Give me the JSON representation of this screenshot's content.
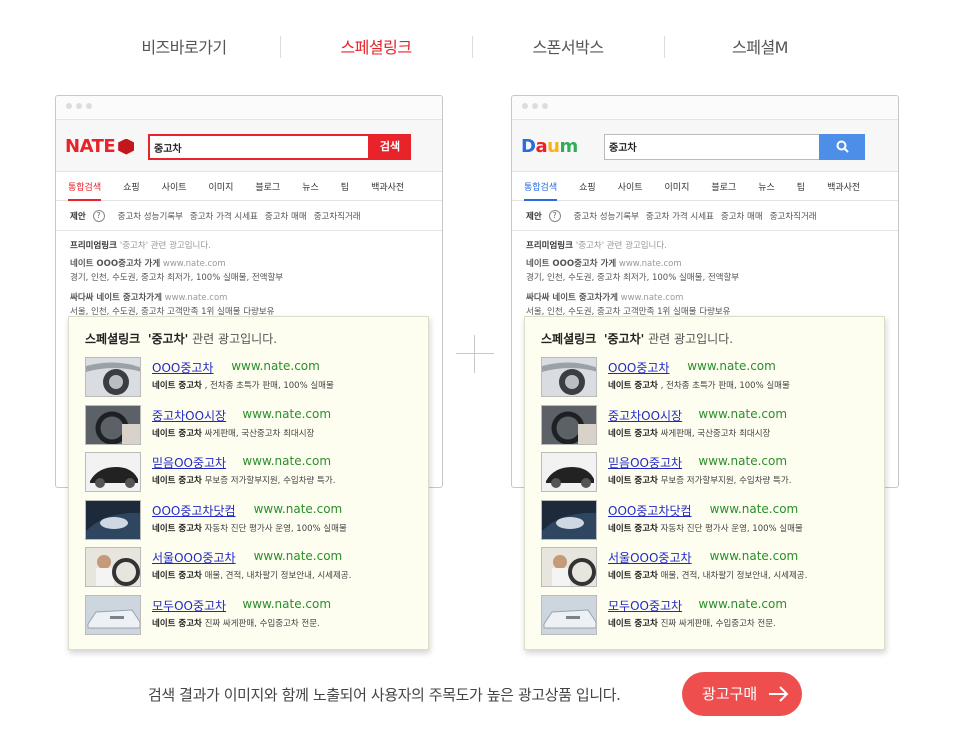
{
  "tabs": [
    "비즈바로가기",
    "스페셜링크",
    "스폰서박스",
    "스페셜M"
  ],
  "active_tab": 1,
  "nate": {
    "logo": "NATE",
    "query": "중고차",
    "search_label": "검색"
  },
  "daum": {
    "logo": [
      "D",
      "a",
      "u",
      "m"
    ],
    "logo_colors": [
      "#2a6be0",
      "#e8232a",
      "#fbb117",
      "#2fae55"
    ],
    "query": "중고차"
  },
  "nav": [
    "통합검색",
    "쇼핑",
    "사이트",
    "이미지",
    "블로그",
    "뉴스",
    "팁",
    "백과사전"
  ],
  "suggest_label": "제안",
  "suggest_help": "?",
  "suggestions": [
    "중고차 성능기록부",
    "중고차 가격 시세표",
    "중고차 매매",
    "중고차직거래"
  ],
  "premium": {
    "title": "프리미엄링크",
    "subtitle": "'중고차' 관련 광고입니다.",
    "r1_title": "네이트 OOO중고차 가게",
    "r1_url": "www.nate.com",
    "r1_desc": "경기, 인천, 수도권, 중고차 최저가, 100% 실매물, 전액할부",
    "r2_title": "싸다싸 네이트 중고차가게",
    "r2_url": "www.nate.com",
    "r2_desc": "서울, 인천, 수도권, 중고차 고객만족 1위 실매물 다량보유"
  },
  "popup": {
    "title": "스페셜링크",
    "keyword": "'중고차'",
    "suffix": "관련 광고입니다.",
    "ads": [
      {
        "title": "OOO중고차",
        "url": "www.nate.com",
        "brand": "네이트 중고차",
        "desc": ", 전차종 초특가 판매, 100% 실매물"
      },
      {
        "title": "중고차OO시장",
        "url": "www.nate.com",
        "brand": "네이트 중고차",
        "desc": "싸게판매, 국산중고차 최대시장"
      },
      {
        "title": "믿음OO중고차",
        "url": "www.nate.com",
        "brand": "네이트 중고차",
        "desc": "무보증 저가할부지원, 수입차량 특가."
      },
      {
        "title": "OOO중고차닷컴",
        "url": "www.nate.com",
        "brand": "네이트 중고차",
        "desc": "자동차 진단 평가사 운영, 100% 실매물"
      },
      {
        "title": "서울OOO중고차",
        "url": "www.nate.com",
        "brand": "네이트 중고차",
        "desc": "매물, 견적, 내차팔기 정보안내, 시세제공."
      },
      {
        "title": "모두OO중고차",
        "url": "www.nate.com",
        "brand": "네이트 중고차",
        "desc": "진짜 싸게판매, 수입중고차 전문."
      }
    ]
  },
  "footer": {
    "text": "검색 결과가 이미지와 함께 노출되어 사용자의 주목도가 높은 광고상품 입니다.",
    "button": "광고구매"
  },
  "colors": {
    "accent_red": "#e8232a",
    "daum_blue": "#4d8ee8",
    "link_blue": "#2329c6",
    "url_green": "#2a8f2a",
    "buy_button": "#ef4e4e"
  }
}
